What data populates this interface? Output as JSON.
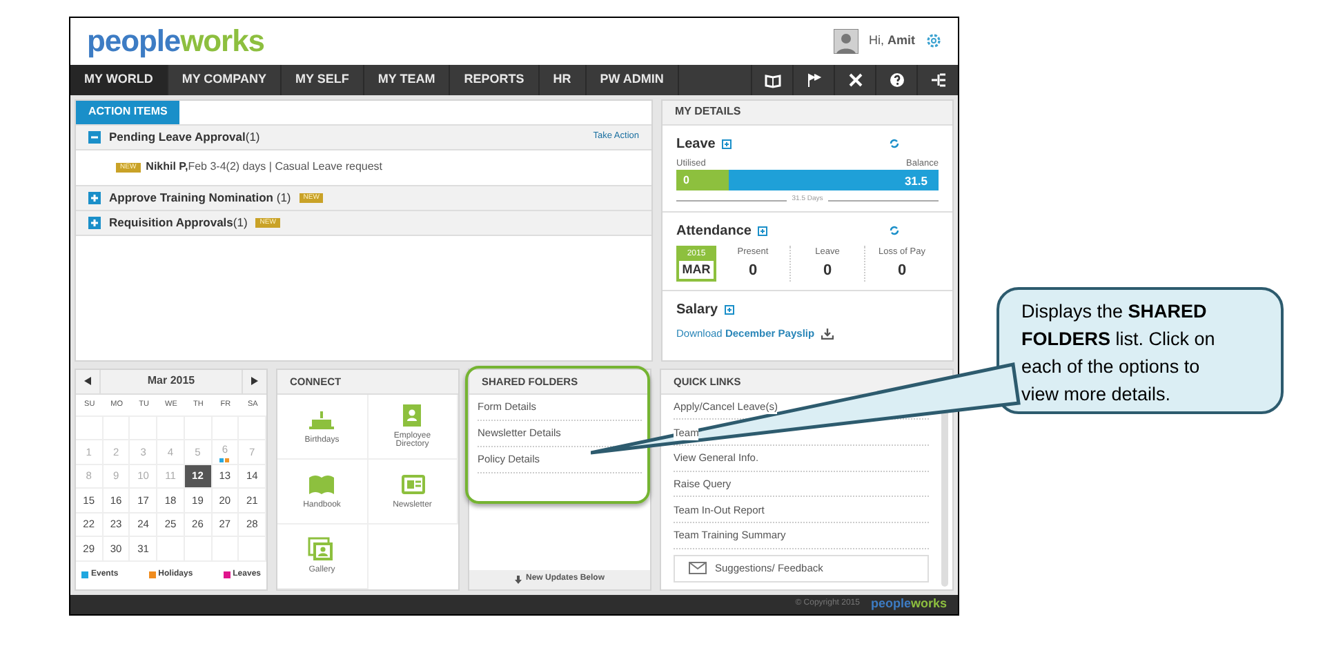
{
  "header": {
    "logo": {
      "part_1": "people",
      "part_2": "works"
    },
    "greeting": "Hi, ",
    "user": "Amit"
  },
  "nav": {
    "items": [
      {
        "label": "MY WORLD",
        "selected": true
      },
      {
        "label": "MY COMPANY",
        "selected": false
      },
      {
        "label": "MY SELF",
        "selected": false
      },
      {
        "label": "MY TEAM",
        "selected": false
      },
      {
        "label": "REPORTS",
        "selected": false
      },
      {
        "label": "HR",
        "selected": false
      },
      {
        "label": "PW ADMIN",
        "selected": false
      }
    ]
  },
  "action_items": {
    "tab": "ACTION ITEMS",
    "groups": [
      {
        "title": "Pending Leave Approval",
        "count": "(1)",
        "expanded": true,
        "is_new": false,
        "action": "Take Action",
        "entries": [
          {
            "badge": "NEW",
            "name": "Nikhil P,",
            "detail": "Feb 3-4(2) days | Casual Leave request"
          }
        ]
      },
      {
        "title": "Approve Training Nomination ",
        "count": "(1)",
        "expanded": false,
        "is_new": true,
        "badge": "NEW"
      },
      {
        "title": "Requisition Approvals",
        "count": "(1)",
        "expanded": false,
        "is_new": true,
        "badge": "NEW"
      }
    ]
  },
  "my_details": {
    "title": "MY DETAILS",
    "leave": {
      "title": "Leave",
      "utilised_label": "Utilised",
      "balance_label": "Balance",
      "utilised": "0",
      "balance": "31.5",
      "level": 0.2,
      "total": "31.5 Days"
    },
    "attendance": {
      "title": "Attendance",
      "year": "2015",
      "month": "MAR",
      "stats": [
        {
          "label": "Present",
          "value": "0"
        },
        {
          "label": "Leave",
          "value": "0"
        },
        {
          "label": "Loss of Pay",
          "value": "0"
        }
      ]
    },
    "salary": {
      "title": "Salary",
      "link_prefix": "Download ",
      "link": "December Payslip"
    }
  },
  "calendar": {
    "month": "Mar 2015",
    "weekdays": [
      "SU",
      "MO",
      "TU",
      "WE",
      "TH",
      "FR",
      "SA"
    ],
    "weeks": [
      [
        {
          "day": "1",
          "muted": true,
          "selected": false
        },
        {
          "day": "2",
          "muted": true,
          "selected": false
        },
        {
          "day": "3",
          "muted": true,
          "selected": false
        },
        {
          "day": "4",
          "muted": true,
          "selected": false
        },
        {
          "day": "5",
          "muted": true,
          "selected": false
        },
        {
          "day": "6",
          "muted": true,
          "selected": false,
          "markers": [
            {
              "color": "#29a8e0"
            },
            {
              "color": "#f0962a"
            }
          ]
        },
        {
          "day": "7",
          "muted": true,
          "selected": false
        }
      ],
      [
        {
          "day": "8",
          "muted": true,
          "selected": false
        },
        {
          "day": "9",
          "muted": true,
          "selected": false
        },
        {
          "day": "10",
          "muted": true,
          "selected": false
        },
        {
          "day": "11",
          "muted": true,
          "selected": false
        },
        {
          "day": "12",
          "muted": false,
          "selected": true
        },
        {
          "day": "13",
          "muted": false,
          "selected": false
        },
        {
          "day": "14",
          "muted": false,
          "selected": false
        }
      ],
      [
        {
          "day": "15",
          "muted": false,
          "selected": false
        },
        {
          "day": "16",
          "muted": false,
          "selected": false
        },
        {
          "day": "17",
          "muted": false,
          "selected": false
        },
        {
          "day": "18",
          "muted": false,
          "selected": false
        },
        {
          "day": "19",
          "muted": false,
          "selected": false
        },
        {
          "day": "20",
          "muted": false,
          "selected": false
        },
        {
          "day": "21",
          "muted": false,
          "selected": false
        }
      ],
      [
        {
          "day": "22",
          "muted": false,
          "selected": false
        },
        {
          "day": "23",
          "muted": false,
          "selected": false
        },
        {
          "day": "24",
          "muted": false,
          "selected": false
        },
        {
          "day": "25",
          "muted": false,
          "selected": false
        },
        {
          "day": "26",
          "muted": false,
          "selected": false
        },
        {
          "day": "27",
          "muted": false,
          "selected": false
        },
        {
          "day": "28",
          "muted": false,
          "selected": false
        }
      ],
      [
        {
          "day": "29",
          "muted": false,
          "selected": false
        },
        {
          "day": "30",
          "muted": false,
          "selected": false
        },
        {
          "day": "31",
          "muted": false,
          "selected": false
        }
      ]
    ],
    "legend": [
      {
        "label": "Events",
        "color": "#1fa7e0"
      },
      {
        "label": "Holidays",
        "color": "#f08c1e"
      },
      {
        "label": "Leaves",
        "color": "#e0148c"
      }
    ]
  },
  "connect": {
    "title": "CONNECT",
    "items": [
      {
        "label": "Birthdays",
        "kind": "cake"
      },
      {
        "label": "Employee Directory",
        "kind": "directory"
      },
      {
        "label": "Handbook",
        "kind": "book"
      },
      {
        "label": "Newsletter",
        "kind": "newsletter"
      },
      {
        "label": "Gallery",
        "kind": "gallery"
      }
    ]
  },
  "shared_folders": {
    "title": "SHARED FOLDERS",
    "items": [
      "Form Details",
      "Newsletter Details",
      "Policy Details"
    ],
    "footer": "New Updates Below",
    "highlighted": true
  },
  "quick_links": {
    "title": "QUICK LINKS",
    "items": [
      "Apply/Cancel Leave(s)",
      "Team",
      "View General Info.",
      "Raise Query",
      "Team In-Out Report",
      "Team Training Summary"
    ],
    "feedback": "Suggestions/ Feedback"
  },
  "footer": {
    "copyright": "© Copyright 2015",
    "logo": {
      "part_1": "people",
      "part_2": "works"
    }
  },
  "callout": {
    "text": "Displays the **SHARED FOLDERS** list. Click on each of the options to view more details."
  }
}
